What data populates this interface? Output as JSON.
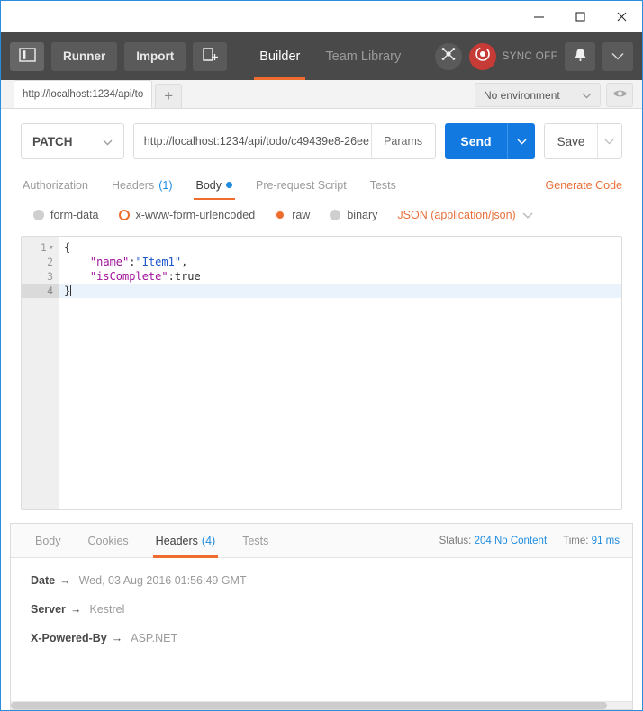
{
  "titlebar": {
    "minimize_label": "minimize",
    "maximize_label": "maximize",
    "close_label": "close"
  },
  "header": {
    "sidebar_toggle_label": "",
    "runner_label": "Runner",
    "import_label": "Import",
    "new_label": "",
    "nav_tabs": [
      {
        "label": "Builder",
        "active": true
      },
      {
        "label": "Team Library",
        "active": false
      }
    ],
    "interceptor_label": "",
    "sync_label": "SYNC OFF",
    "notifications_label": "",
    "account_caret_label": "",
    "accent_orange": "#ef6b2e",
    "sync_red": "#c73b36"
  },
  "tabstrip": {
    "request_tab_title": "http://localhost:1234/api/to",
    "new_tab_label": "+",
    "environment": {
      "selected": "No environment",
      "caret": "chevron-down"
    },
    "eye_label": ""
  },
  "request": {
    "method": "PATCH",
    "url": "http://localhost:1234/api/todo/c49439e8-26ee",
    "params_label": "Params",
    "send_label": "Send",
    "save_label": "Save",
    "tabs": [
      {
        "label": "Authorization",
        "count": "",
        "active": false,
        "dot": false
      },
      {
        "label": "Headers",
        "count": "(1)",
        "active": false,
        "dot": false
      },
      {
        "label": "Body",
        "count": "",
        "active": true,
        "dot": true
      },
      {
        "label": "Pre-request Script",
        "count": "",
        "active": false,
        "dot": false
      },
      {
        "label": "Tests",
        "count": "",
        "active": false,
        "dot": false
      }
    ],
    "generate_code_label": "Generate Code",
    "body_types": [
      {
        "label": "form-data",
        "state": "off"
      },
      {
        "label": "x-www-form-urlencoded",
        "state": "ring"
      },
      {
        "label": "raw",
        "state": "selected"
      },
      {
        "label": "binary",
        "state": "off"
      }
    ],
    "content_type": "JSON (application/json)",
    "editor": {
      "lines": [
        {
          "no": "1",
          "foldable": true,
          "current": false,
          "tokens": [
            {
              "t": "{",
              "c": "tok-punc"
            }
          ]
        },
        {
          "no": "2",
          "foldable": false,
          "current": false,
          "tokens": [
            {
              "t": "    ",
              "c": "tok-punc"
            },
            {
              "t": "\"name\"",
              "c": "tok-key"
            },
            {
              "t": ":",
              "c": "tok-punc"
            },
            {
              "t": "\"Item1\"",
              "c": "tok-str"
            },
            {
              "t": ",",
              "c": "tok-punc"
            }
          ]
        },
        {
          "no": "3",
          "foldable": false,
          "current": false,
          "tokens": [
            {
              "t": "    ",
              "c": "tok-punc"
            },
            {
              "t": "\"isComplete\"",
              "c": "tok-key"
            },
            {
              "t": ":",
              "c": "tok-punc"
            },
            {
              "t": "true",
              "c": "tok-bool"
            }
          ]
        },
        {
          "no": "4",
          "foldable": false,
          "current": true,
          "tokens": [
            {
              "t": "}",
              "c": "tok-punc"
            }
          ]
        }
      ]
    }
  },
  "response": {
    "tabs": [
      {
        "label": "Body",
        "count": "",
        "active": false
      },
      {
        "label": "Cookies",
        "count": "",
        "active": false
      },
      {
        "label": "Headers",
        "count": "(4)",
        "active": true
      },
      {
        "label": "Tests",
        "count": "",
        "active": false
      }
    ],
    "status_label": "Status:",
    "status_value": "204 No Content",
    "time_label": "Time:",
    "time_value": "91 ms",
    "headers": [
      {
        "name": "Date",
        "arrow": "→",
        "value": "Wed, 03 Aug 2016 01:56:49 GMT"
      },
      {
        "name": "Server",
        "arrow": "→",
        "value": "Kestrel"
      },
      {
        "name": "X-Powered-By",
        "arrow": "→",
        "value": "ASP.NET"
      }
    ]
  }
}
